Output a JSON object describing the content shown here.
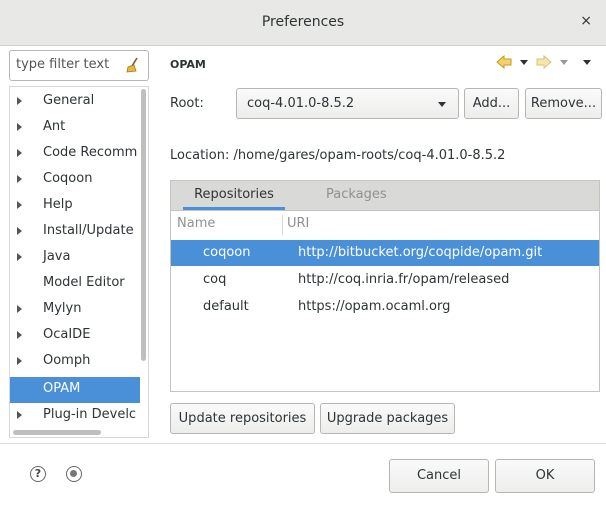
{
  "window": {
    "title": "Preferences",
    "close_glyph": "×"
  },
  "filter": {
    "placeholder": "type filter text",
    "icon": "broom-icon"
  },
  "tree": {
    "items": [
      {
        "label": "General",
        "expandable": true
      },
      {
        "label": "Ant",
        "expandable": true
      },
      {
        "label": "Code Recomm",
        "expandable": true
      },
      {
        "label": "Coqoon",
        "expandable": true
      },
      {
        "label": "Help",
        "expandable": true
      },
      {
        "label": "Install/Update",
        "expandable": true
      },
      {
        "label": "Java",
        "expandable": true
      },
      {
        "label": "Model Editor",
        "expandable": false
      },
      {
        "label": "Mylyn",
        "expandable": true
      },
      {
        "label": "OcaIDE",
        "expandable": true
      },
      {
        "label": "Oomph",
        "expandable": true
      },
      {
        "label": "OPAM",
        "expandable": false,
        "selected": true
      },
      {
        "label": "Plug-in Develc",
        "expandable": true
      }
    ]
  },
  "panel": {
    "title": "OPAM",
    "root_label": "Root:",
    "root_value": "coq-4.01.0-8.5.2",
    "add_label": "Add...",
    "remove_label": "Remove...",
    "location": "Location: /home/gares/opam-roots/coq-4.01.0-8.5.2",
    "tabs": [
      "Repositories",
      "Packages"
    ],
    "columns": [
      "Name",
      "URI"
    ],
    "rows": [
      {
        "name": "coqoon",
        "uri": "http://bitbucket.org/coqpide/opam.git",
        "selected": true
      },
      {
        "name": "coq",
        "uri": "http://coq.inria.fr/opam/released"
      },
      {
        "name": "default",
        "uri": "https://opam.ocaml.org"
      }
    ],
    "update_label": "Update repositories",
    "upgrade_label": "Upgrade packages"
  },
  "footer": {
    "help_glyph": "?",
    "cancel_label": "Cancel",
    "ok_label": "OK"
  },
  "colors": {
    "accent": "#4a90d9",
    "arrow": "#e8b838"
  }
}
